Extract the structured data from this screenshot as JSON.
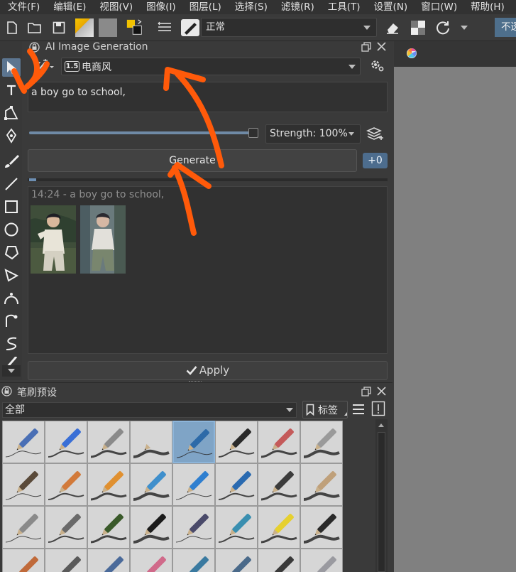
{
  "menubar": {
    "items": [
      "文件(F)",
      "编辑(E)",
      "视图(V)",
      "图像(I)",
      "图层(L)",
      "选择(S)",
      "滤镜(R)",
      "工具(T)",
      "设置(N)",
      "窗口(W)",
      "帮助(H)"
    ]
  },
  "toolbar": {
    "blend_mode": "正常",
    "opacity_label": "不透明"
  },
  "ai_panel": {
    "title": "AI Image Generation",
    "style_badge": "1.5",
    "style_name": "电商风",
    "prompt": "a boy go to school,",
    "strength_label": "Strength: 100%",
    "strength_value": 1.0,
    "generate_label": "Generate",
    "queue_count": "+0",
    "progress": 0.02,
    "history_caption": "14:24 - a boy go to school,",
    "apply_label": "Apply"
  },
  "brush_panel": {
    "title": "笔刷预设",
    "filter": "全部",
    "tag_label": "标签"
  },
  "colors": {
    "accent": "#5c7590",
    "annotation": "#ff5a0a"
  }
}
